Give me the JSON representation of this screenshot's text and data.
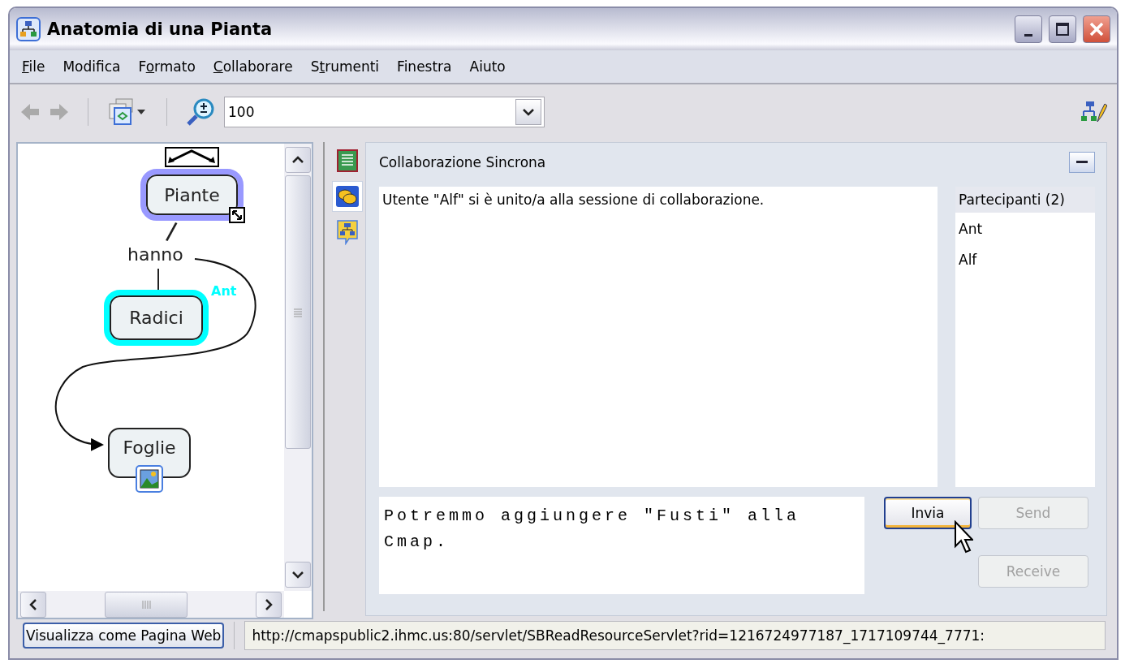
{
  "window": {
    "title": "Anatomia di una Pianta"
  },
  "menu": [
    {
      "key": "F",
      "after": "ile"
    },
    {
      "before": "Modifica"
    },
    {
      "before": "F",
      "key": "o",
      "after": "rmato"
    },
    {
      "key": "C",
      "after": "ollaborare"
    },
    {
      "before": "S",
      "key": "t",
      "after": "rumenti"
    },
    {
      "before": "Finestra"
    },
    {
      "before": "Aiuto"
    }
  ],
  "toolbar": {
    "zoom": {
      "value": "100"
    }
  },
  "cmap": {
    "nodes": [
      {
        "kind": "concept",
        "label": "Piante",
        "color": "#9999ff",
        "resize_handle": true
      },
      {
        "kind": "linking",
        "label": "hanno"
      },
      {
        "kind": "concept",
        "label": "Radici",
        "color": "#00ffff"
      },
      {
        "kind": "concept",
        "label": "Foglie",
        "image": true
      }
    ],
    "cursor": {
      "label": "Ant",
      "color": "#00ffff"
    }
  },
  "side_tabs": [
    {
      "selected": false
    },
    {
      "selected": true
    },
    {
      "selected": false
    }
  ],
  "collaboration": {
    "title": "Collaborazione Sincrona",
    "log": [
      "Utente \"Alf\" si è unito/a alla sessione di collaborazione."
    ],
    "participants": {
      "header": "Partecipanti (2)",
      "items": [
        "Ant",
        "Alf"
      ]
    },
    "message": {
      "value": "Potremmo aggiungere \"Fusti\" alla Cmap."
    },
    "buttons": [
      {
        "label": "Invia",
        "disabled": false,
        "focused": true
      },
      {
        "label": "Send",
        "disabled": true,
        "focused": false
      },
      {
        "label": "Receive",
        "disabled": true,
        "focused": false
      }
    ]
  },
  "status_bar": {
    "button": "Visualizza come Pagina Web",
    "url": "http://cmapspublic2.ihmc.us:80/servlet/SBReadResourceServlet?rid=1216724977187_1717109744_7771:"
  }
}
